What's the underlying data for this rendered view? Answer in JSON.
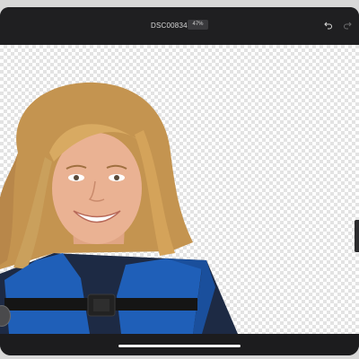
{
  "header": {
    "document_title": "DSC00834 *",
    "zoom_level": "47%"
  },
  "toolbar": {
    "undo_icon": "undo-icon",
    "redo_icon": "redo-icon"
  },
  "canvas": {
    "background": "transparency-checkerboard",
    "subject": "girl-in-life-jacket-cutout"
  },
  "colors": {
    "topbar": "#1f1f21",
    "chip": "#3a3a3d",
    "life_jacket": "#1f5fb8",
    "hair": "#c89a55"
  }
}
